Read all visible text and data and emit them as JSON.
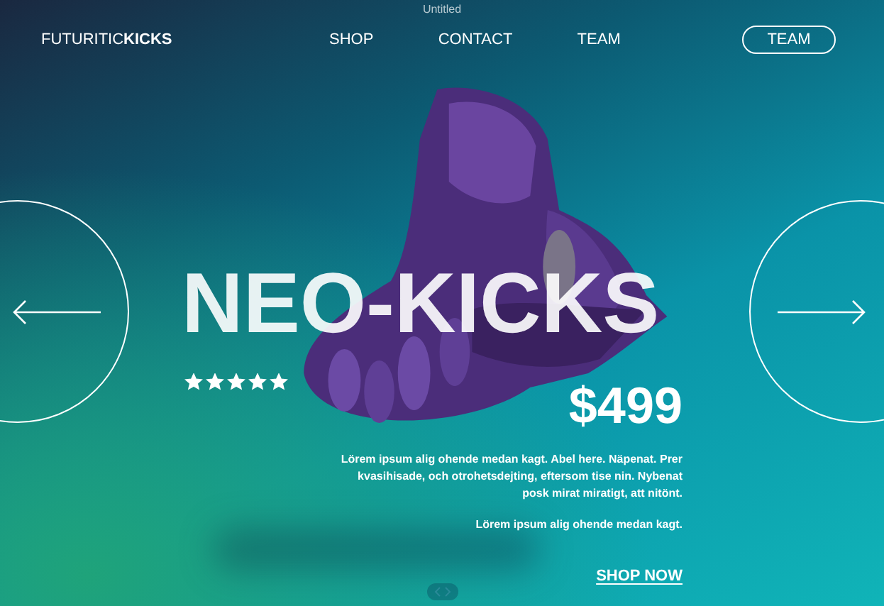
{
  "window": {
    "title": "Untitled"
  },
  "brand": {
    "light": "FUTURITIC",
    "bold": "KICKS"
  },
  "nav": [
    {
      "label": "SHOP",
      "kind": "link"
    },
    {
      "label": "CONTACT",
      "kind": "link"
    },
    {
      "label": "TEAM",
      "kind": "link"
    },
    {
      "label": "TEAM",
      "kind": "outlined"
    }
  ],
  "hero": {
    "title": "NEO-KICKS",
    "stars": 5,
    "price": "$499",
    "paragraphs": [
      "Lörem ipsum alig ohende medan kagt. Abel here. Näpenat. Prer kvasihisade, och otrohetsdejting, eftersom tise nin. Nybenat posk mirat miratigt, att nitönt.",
      "Lörem ipsum alig ohende medan kagt."
    ],
    "cta": "SHOP NOW"
  }
}
